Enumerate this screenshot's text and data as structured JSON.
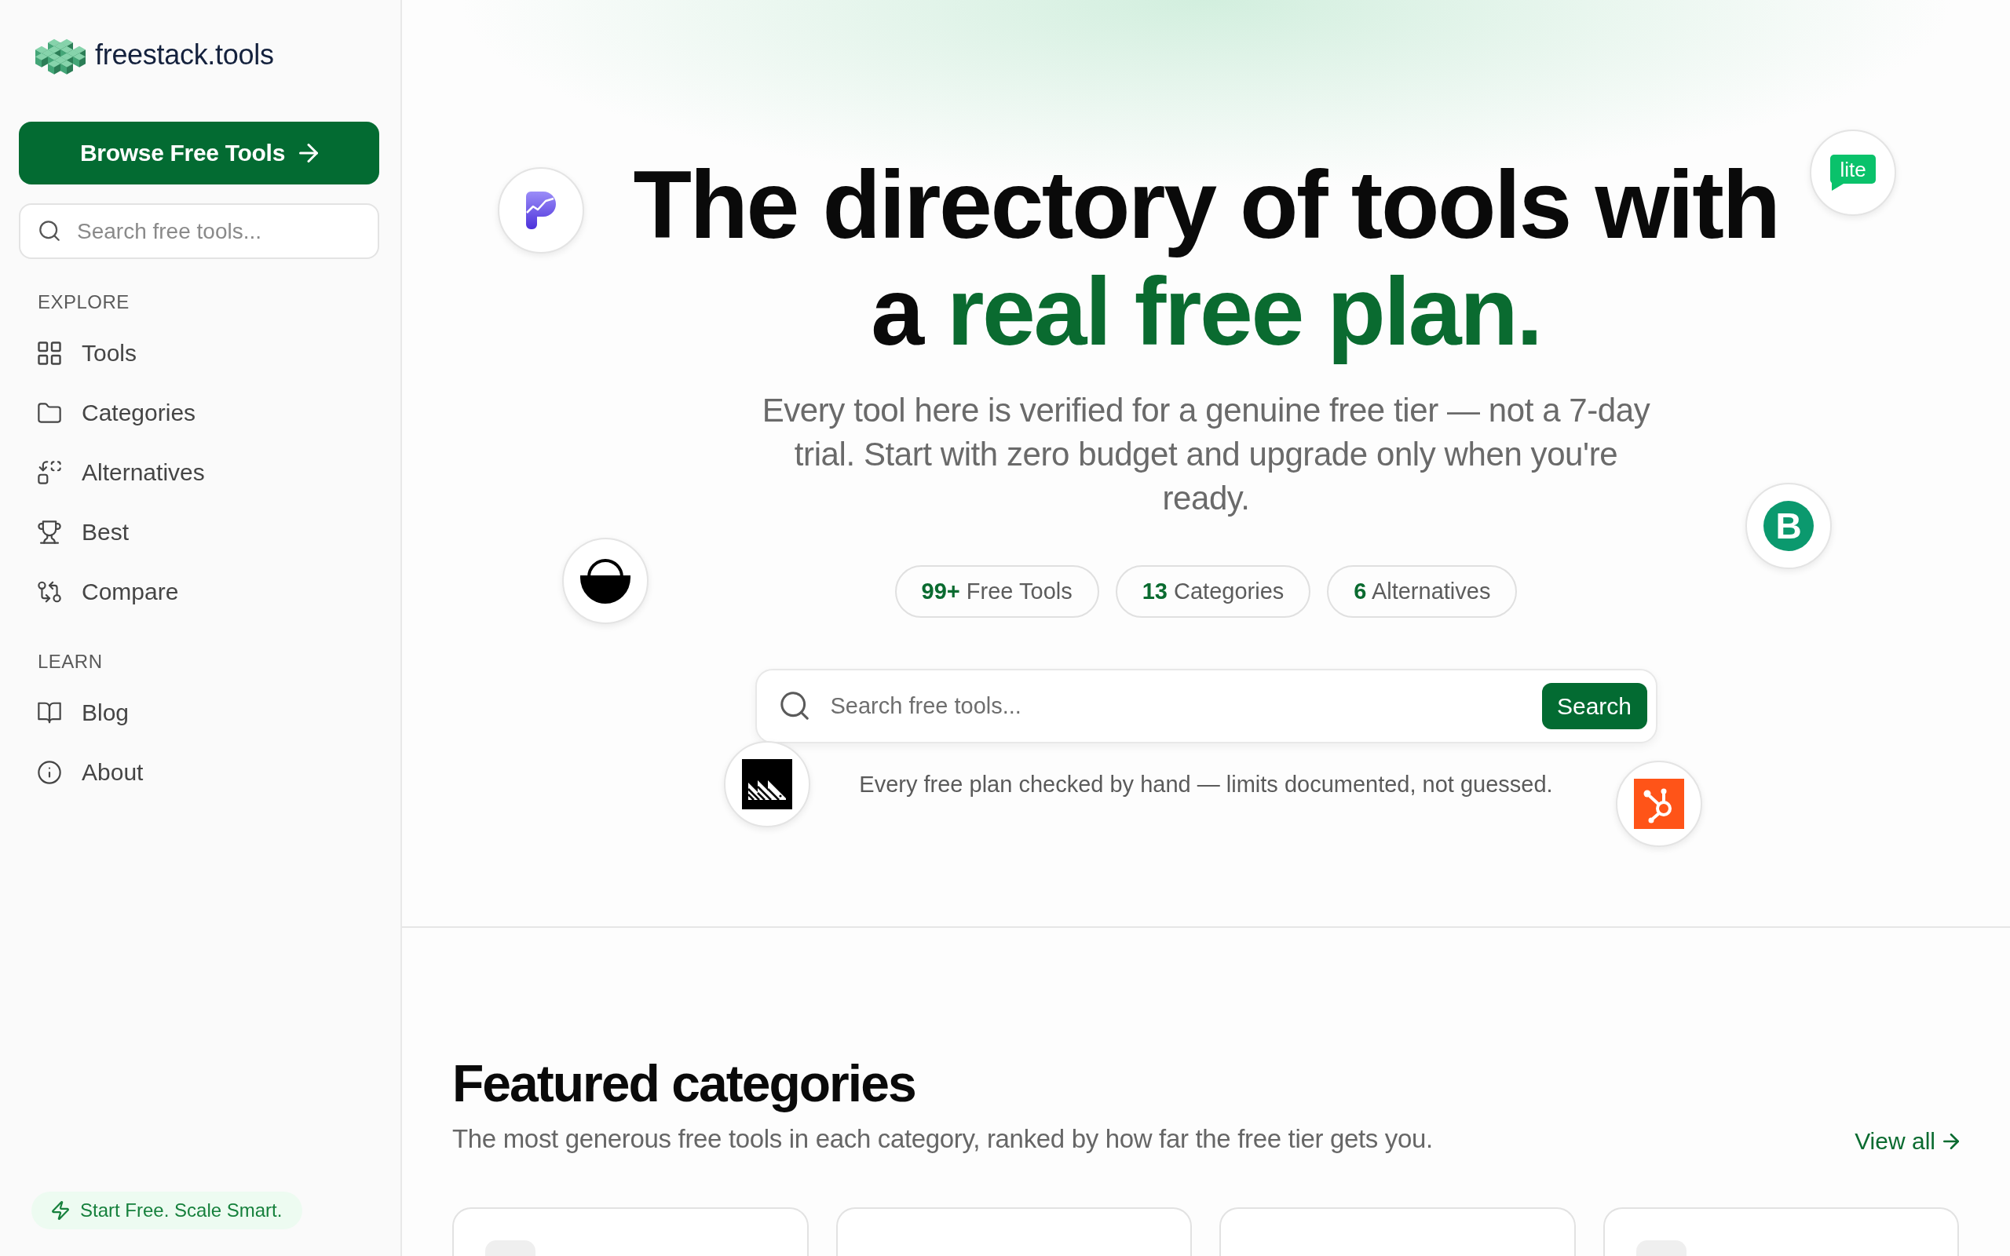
{
  "sidebar": {
    "logo": "freestack.tools",
    "browse_button": "Browse Free Tools",
    "search": {
      "placeholder": "Search free tools..."
    },
    "sections": [
      {
        "title": "EXPLORE",
        "items": [
          {
            "label": "Tools",
            "selected": false
          },
          {
            "label": "Categories",
            "selected": false
          },
          {
            "label": "Alternatives",
            "selected": false
          },
          {
            "label": "Best",
            "selected": false
          },
          {
            "label": "Compare",
            "selected": false
          }
        ]
      },
      {
        "title": "LEARN",
        "items": [
          {
            "label": "Blog",
            "selected": false
          },
          {
            "label": "About",
            "selected": false
          }
        ]
      }
    ],
    "tagline": "Start Free. Scale Smart."
  },
  "hero": {
    "title": "The directory of tools with a",
    "title_highlight": "real free plan.",
    "description": "Every tool here is verified for a genuine free tier — not a 7-day trial. Start with zero budget and upgrade only when you're ready.",
    "stats": [
      {
        "value": "99+",
        "label": "Free Tools"
      },
      {
        "value": "13",
        "label": "Categories"
      },
      {
        "value": "6",
        "label": "Alternatives"
      }
    ],
    "search": {
      "placeholder": "Search free tools...",
      "button": "Search"
    },
    "note": "Every free plan checked by hand — limits documented, not guessed.",
    "floating_logos": [
      {
        "kind": "bubble",
        "text": "lite"
      },
      {
        "kind": "pmark"
      },
      {
        "kind": "monogram",
        "text": "B"
      },
      {
        "kind": "basket"
      },
      {
        "kind": "hedgehog"
      },
      {
        "kind": "sprocket"
      }
    ]
  },
  "featured_categories": {
    "title": "Featured categories",
    "subtitle": "The most generous free tools in each category, ranked by how far the free tier gets you.",
    "view_all": "View all",
    "cards": [
      {
        "kind": "tile"
      },
      {
        "kind": "plain"
      },
      {
        "kind": "plain"
      },
      {
        "kind": "tile"
      }
    ]
  }
}
